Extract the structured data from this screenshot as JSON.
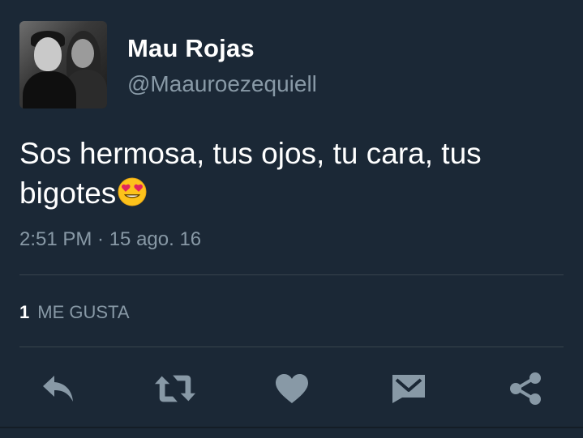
{
  "tweet": {
    "display_name": "Mau Rojas",
    "handle": "@Maauroezequiell",
    "text": "Sos hermosa, tus ojos, tu cara, tus bigotes",
    "emoji": "smiling-face-with-heart-eyes",
    "timestamp": "2:51 PM · 15 ago. 16",
    "likes_count": "1",
    "likes_label": "ME GUSTA"
  },
  "actions": {
    "reply_icon": "reply-icon",
    "retweet_icon": "retweet-icon",
    "like_icon": "heart-icon",
    "dm_icon": "envelope-icon",
    "share_icon": "share-icon"
  },
  "colors": {
    "background": "#1b2836",
    "primary_text": "#ffffff",
    "secondary_text": "#8899a6",
    "divider": "#38444d",
    "icon": "#8899a6"
  }
}
